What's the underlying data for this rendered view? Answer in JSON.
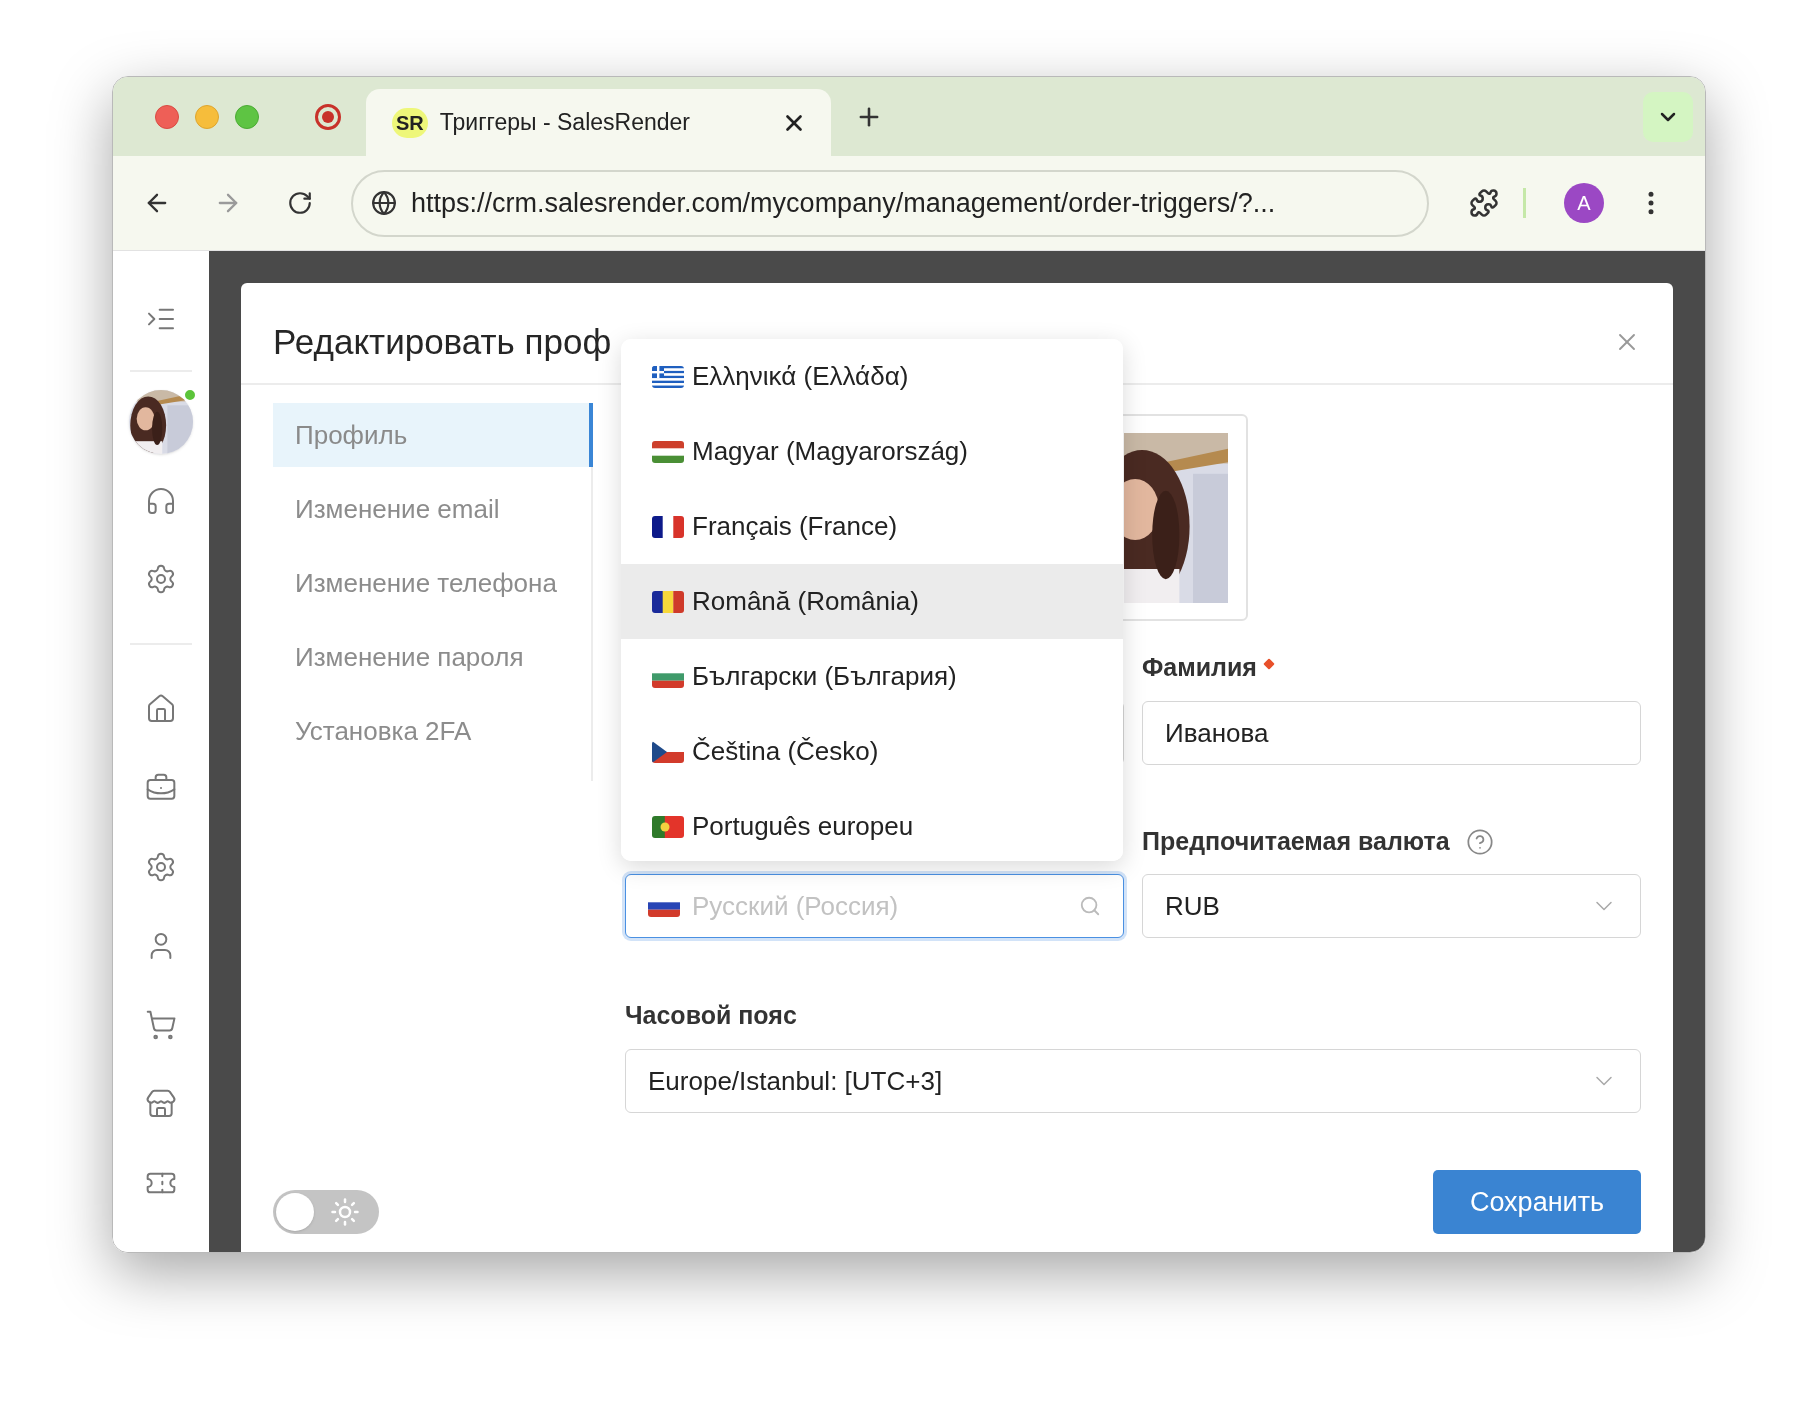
{
  "browser": {
    "tab_logo": "SR",
    "tab_title": "Триггеры - SalesRender",
    "url": "https://crm.salesrender.com/mycompany/management/order-triggers/?...",
    "profile_initial": "A"
  },
  "sidebar": {
    "user_online": true
  },
  "modal": {
    "title": "Редактировать проф",
    "nav": [
      {
        "label": "Профиль",
        "selected": true
      },
      {
        "label": "Изменение email",
        "selected": false
      },
      {
        "label": "Изменение телефона",
        "selected": false
      },
      {
        "label": "Изменение пароля",
        "selected": false
      },
      {
        "label": "Установка 2FA",
        "selected": false
      }
    ],
    "last_name": {
      "label": "Фамилия",
      "required": true,
      "value": "Иванова"
    },
    "language_field": {
      "placeholder": "Русский (Россия)",
      "kind": "ru",
      "focused": true
    },
    "language_options": [
      {
        "label": "Ελληνικά (Ελλάδα)",
        "kind": "gr",
        "selected": false
      },
      {
        "label": "Magyar (Magyarország)",
        "kind": "hu",
        "selected": false
      },
      {
        "label": "Français (France)",
        "kind": "fr",
        "selected": false
      },
      {
        "label": "Română (România)",
        "kind": "ro",
        "selected": true
      },
      {
        "label": "Български (България)",
        "kind": "bg",
        "selected": false
      },
      {
        "label": "Čeština (Česko)",
        "kind": "cz",
        "selected": false
      },
      {
        "label": "Português europeu",
        "kind": "pt",
        "selected": false
      }
    ],
    "currency": {
      "label": "Предпочитаемая валюта",
      "value": "RUB"
    },
    "timezone": {
      "label": "Часовой пояс",
      "value": "Europe/Istanbul: [UTC+3]"
    },
    "theme_toggle": {
      "on": false
    },
    "save_button": "Сохранить"
  }
}
